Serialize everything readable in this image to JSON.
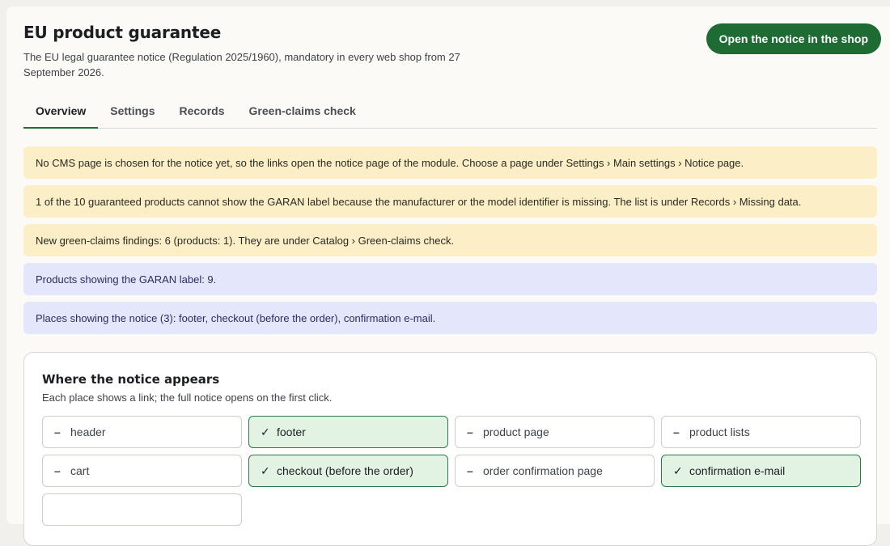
{
  "header": {
    "title": "EU product guarantee",
    "subtitle": "The EU legal guarantee notice (Regulation 2025/1960), mandatory in every web shop from 27 September 2026.",
    "cta_label": "Open the notice in the shop"
  },
  "tabs": [
    {
      "label": "Overview",
      "active": true
    },
    {
      "label": "Settings",
      "active": false
    },
    {
      "label": "Records",
      "active": false
    },
    {
      "label": "Green-claims check",
      "active": false
    }
  ],
  "alerts": [
    {
      "type": "warning",
      "text": "No CMS page is chosen for the notice yet, so the links open the notice page of the module. Choose a page under Settings › Main settings › Notice page."
    },
    {
      "type": "warning",
      "text": "1 of the 10 guaranteed products cannot show the GARAN label because the manufacturer or the model identifier is missing. The list is under Records › Missing data."
    },
    {
      "type": "warning",
      "text": "New green-claims findings: 6 (products: 1). They are under Catalog › Green-claims check."
    },
    {
      "type": "info",
      "text": "Products showing the GARAN label: 9."
    },
    {
      "type": "info",
      "text": "Places showing the notice (3): footer, checkout (before the order), confirmation e-mail."
    }
  ],
  "placements": {
    "title": "Where the notice appears",
    "subtitle": "Each place shows a link; the full notice opens on the first click.",
    "items": [
      {
        "label": "header",
        "enabled": false,
        "mark": "–"
      },
      {
        "label": "footer",
        "enabled": true,
        "mark": "✓"
      },
      {
        "label": "product page",
        "enabled": false,
        "mark": "–"
      },
      {
        "label": "product lists",
        "enabled": false,
        "mark": "–"
      },
      {
        "label": "cart",
        "enabled": false,
        "mark": "–"
      },
      {
        "label": "checkout (before the order)",
        "enabled": true,
        "mark": "✓"
      },
      {
        "label": "order confirmation page",
        "enabled": false,
        "mark": "–"
      },
      {
        "label": "confirmation e-mail",
        "enabled": true,
        "mark": "✓"
      }
    ]
  },
  "colors": {
    "accent": "#1e6b34",
    "warning_bg": "#fcefc7",
    "info_bg": "#e4e6fb",
    "enabled_bg": "#e2f2e3"
  }
}
